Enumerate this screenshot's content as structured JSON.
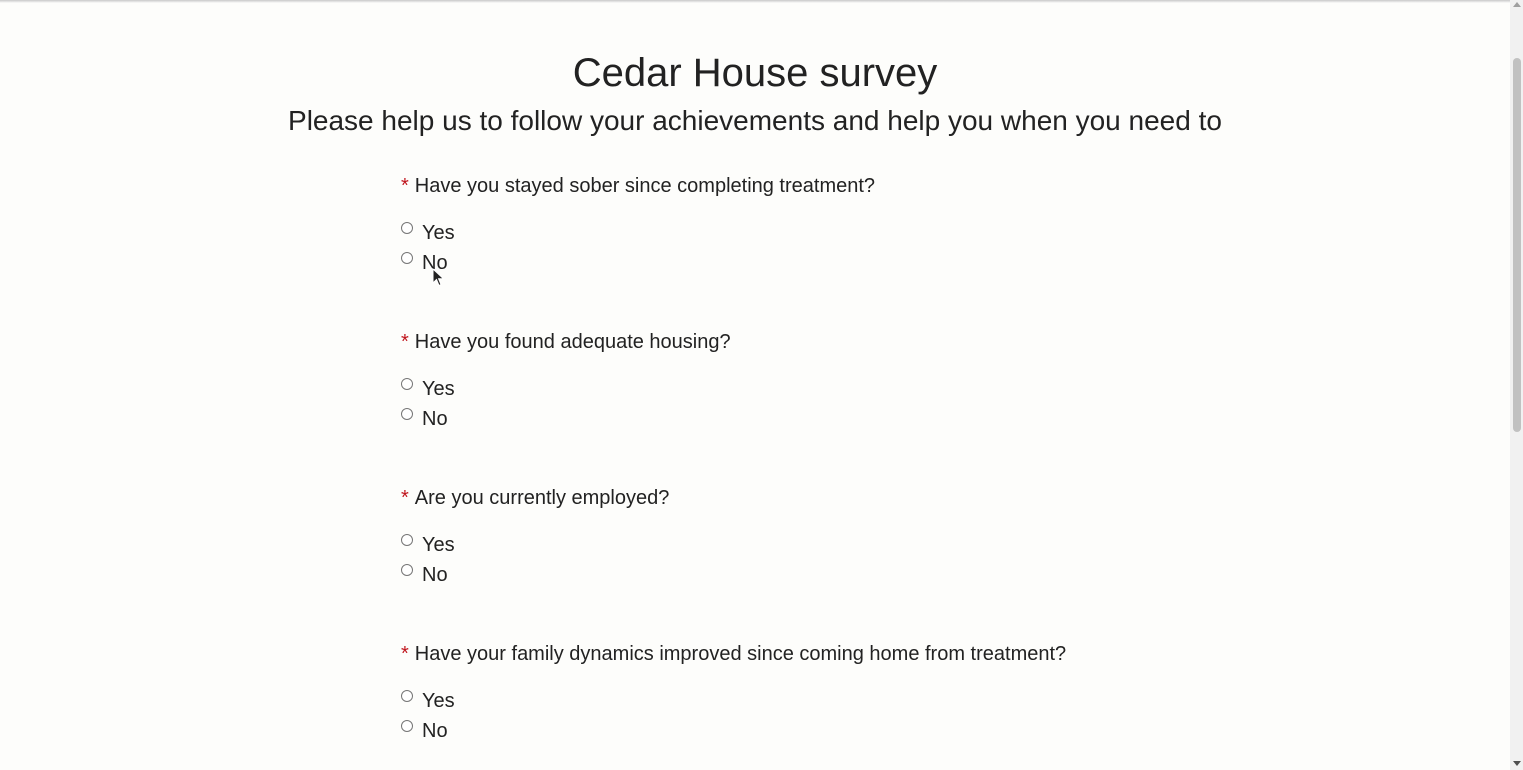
{
  "survey": {
    "title": "Cedar House survey",
    "subtitle": "Please help us to follow your achievements and help you when you need to",
    "required_marker": "*",
    "questions": [
      {
        "label": "Have you stayed sober since completing treatment?",
        "options": [
          "Yes",
          "No"
        ]
      },
      {
        "label": "Have you found adequate housing?",
        "options": [
          "Yes",
          "No"
        ]
      },
      {
        "label": "Are you currently employed?",
        "options": [
          "Yes",
          "No"
        ]
      },
      {
        "label": "Have your family dynamics improved since coming home from treatment?",
        "options": [
          "Yes",
          "No"
        ]
      }
    ]
  },
  "colors": {
    "background": "#fdfdfb",
    "text": "#222222",
    "required": "#c0141c"
  },
  "icons": {
    "cursor": "mouse-pointer-icon"
  }
}
